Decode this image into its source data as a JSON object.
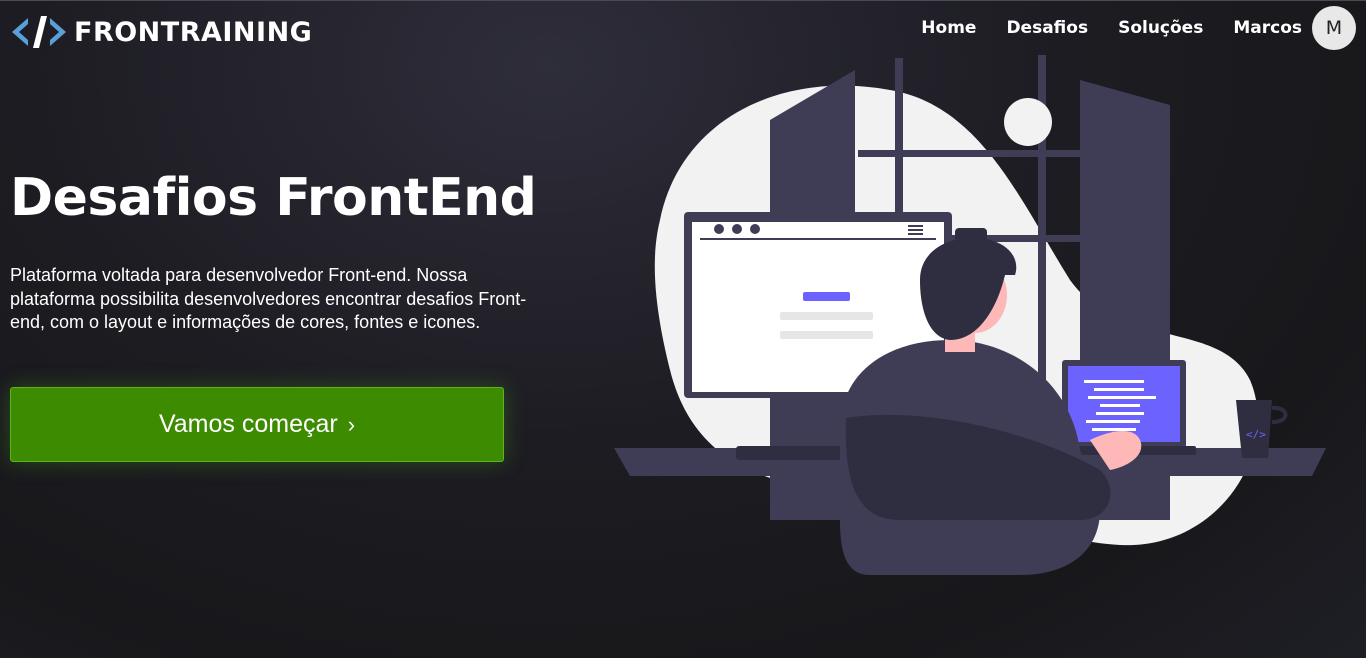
{
  "header": {
    "logo_text": "FRONTRAINING",
    "nav": [
      "Home",
      "Desafios",
      "Soluções"
    ],
    "user_name": "Marcos",
    "avatar_initial": "M"
  },
  "hero": {
    "title": "Desafios FrontEnd",
    "description": "Plataforma voltada para desenvolvedor Front-end. Nossa plataforma possibilita desenvolvedores encontrar desafios Front-end, com o layout e informações de cores, fontes e icones.",
    "cta_label": "Vamos começar",
    "cta_icon": "chevron-right-icon"
  },
  "colors": {
    "cta_bg": "#3d8b00",
    "accent_purple": "#6c63ff",
    "illustration_dark": "#3f3d56"
  }
}
